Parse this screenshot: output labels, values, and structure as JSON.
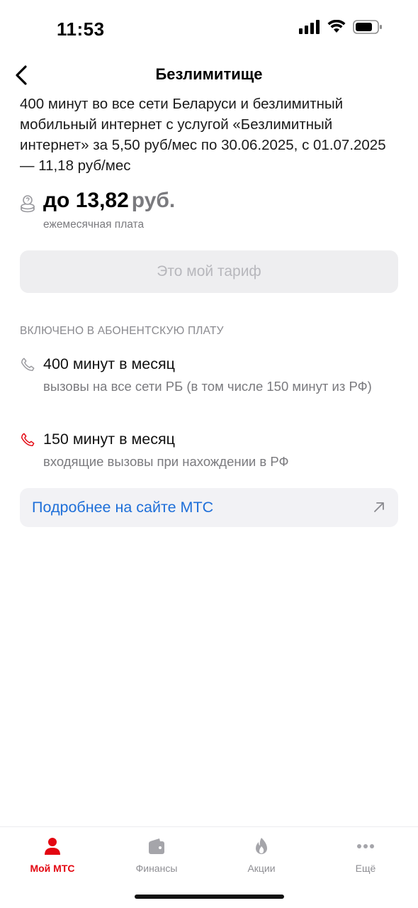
{
  "status_bar": {
    "time": "11:53"
  },
  "nav": {
    "title": "Безлимитище"
  },
  "description": "400 минут во все сети Беларуси и безлимитный мобильный интернет с услугой «Безлимитный интернет» за 5,50 руб/мес по 30.06.2025, с 01.07.2025 — 11,18 руб/мес",
  "price": {
    "value": "до 13,82",
    "unit": "руб.",
    "caption": "ежемесячная плата"
  },
  "my_tariff_button": "Это мой тариф",
  "included": {
    "header": "ВКЛЮЧЕНО В АБОНЕНТСКУЮ ПЛАТУ",
    "items": [
      {
        "title": "400 минут в месяц",
        "subtitle": "вызовы на все сети РБ (в том числе 150 минут из РФ)",
        "icon": "phone-icon"
      },
      {
        "title": "150 минут в месяц",
        "subtitle": "входящие вызовы при нахождении в РФ",
        "icon": "phone-roaming-icon"
      }
    ]
  },
  "more_link": "Подробнее на сайте МТС",
  "tabs": [
    {
      "label": "Мой МТС",
      "icon": "person-icon",
      "active": true
    },
    {
      "label": "Финансы",
      "icon": "wallet-icon",
      "active": false
    },
    {
      "label": "Акции",
      "icon": "flame-icon",
      "active": false
    },
    {
      "label": "Ещё",
      "icon": "more-dots-icon",
      "active": false
    }
  ],
  "colors": {
    "accent": "#e30611",
    "link": "#1e6fd9",
    "muted": "#7a7a7e"
  }
}
